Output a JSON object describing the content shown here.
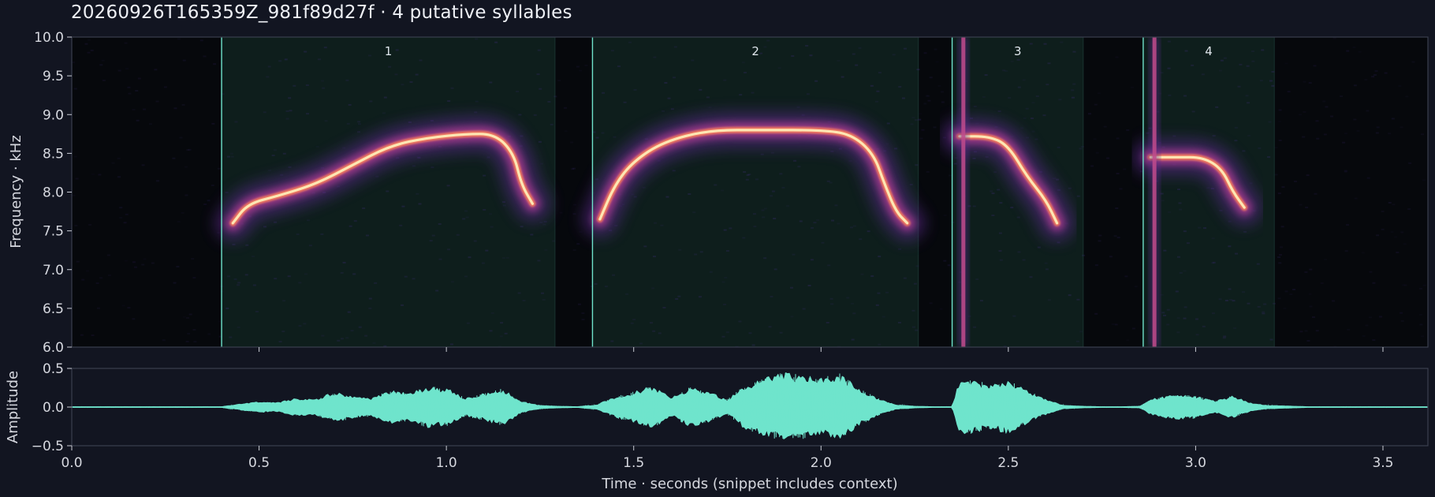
{
  "title": "20260926T165359Z_981f89d27f  ·  4 putative syllables",
  "chart_data": [
    {
      "type": "heatmap",
      "name": "spectrogram",
      "ylabel": "Frequency · kHz",
      "xlim": [
        0.0,
        3.62
      ],
      "ylim": [
        6.0,
        10.0
      ],
      "yticks": [
        6.0,
        6.5,
        7.0,
        7.5,
        8.0,
        8.5,
        9.0,
        9.5,
        10.0
      ],
      "xticks": [
        0.5,
        1.0,
        1.5,
        2.0,
        2.5,
        3.0,
        3.5
      ],
      "syllables": [
        {
          "label": "1",
          "start": 0.4,
          "end": 1.29
        },
        {
          "label": "2",
          "start": 1.39,
          "end": 2.26
        },
        {
          "label": "3",
          "start": 2.35,
          "end": 2.7
        },
        {
          "label": "4",
          "start": 2.86,
          "end": 3.21
        }
      ],
      "ridges": [
        {
          "points": [
            [
              0.43,
              7.6
            ],
            [
              0.47,
              7.85
            ],
            [
              0.55,
              7.95
            ],
            [
              0.65,
              8.1
            ],
            [
              0.75,
              8.35
            ],
            [
              0.85,
              8.6
            ],
            [
              0.95,
              8.7
            ],
            [
              1.05,
              8.75
            ],
            [
              1.13,
              8.75
            ],
            [
              1.18,
              8.5
            ],
            [
              1.2,
              8.1
            ],
            [
              1.23,
              7.85
            ]
          ]
        },
        {
          "points": [
            [
              1.41,
              7.65
            ],
            [
              1.45,
              8.1
            ],
            [
              1.5,
              8.4
            ],
            [
              1.58,
              8.65
            ],
            [
              1.7,
              8.8
            ],
            [
              1.85,
              8.8
            ],
            [
              2.0,
              8.8
            ],
            [
              2.08,
              8.75
            ],
            [
              2.14,
              8.5
            ],
            [
              2.17,
              8.1
            ],
            [
              2.2,
              7.75
            ],
            [
              2.23,
              7.6
            ]
          ]
        },
        {
          "points": [
            [
              2.37,
              8.72
            ],
            [
              2.45,
              8.72
            ],
            [
              2.5,
              8.6
            ],
            [
              2.55,
              8.2
            ],
            [
              2.6,
              7.9
            ],
            [
              2.63,
              7.6
            ]
          ]
        },
        {
          "points": [
            [
              2.88,
              8.45
            ],
            [
              2.95,
              8.45
            ],
            [
              3.02,
              8.45
            ],
            [
              3.07,
              8.3
            ],
            [
              3.1,
              8.0
            ],
            [
              3.13,
              7.8
            ]
          ]
        }
      ],
      "broadband_clicks": [
        2.38,
        2.89
      ]
    },
    {
      "type": "area",
      "name": "waveform",
      "xlabel": "Time · seconds (snippet includes context)",
      "ylabel": "Amplitude",
      "xlim": [
        0.0,
        3.62
      ],
      "ylim": [
        -0.5,
        0.5
      ],
      "yticks": [
        -0.5,
        0.0,
        0.5
      ],
      "xticks": [
        0.0,
        0.5,
        1.0,
        1.5,
        2.0,
        2.5,
        3.0,
        3.5
      ],
      "x": [
        0.0,
        0.4,
        0.45,
        0.5,
        0.55,
        0.6,
        0.65,
        0.7,
        0.75,
        0.8,
        0.85,
        0.9,
        0.95,
        1.0,
        1.05,
        1.1,
        1.15,
        1.2,
        1.25,
        1.3,
        1.35,
        1.4,
        1.45,
        1.5,
        1.55,
        1.6,
        1.65,
        1.7,
        1.75,
        1.8,
        1.85,
        1.9,
        1.95,
        2.0,
        2.05,
        2.1,
        2.15,
        2.2,
        2.25,
        2.3,
        2.35,
        2.37,
        2.4,
        2.45,
        2.5,
        2.55,
        2.6,
        2.65,
        2.7,
        2.75,
        2.8,
        2.85,
        2.88,
        2.9,
        2.95,
        3.0,
        3.05,
        3.1,
        3.15,
        3.2,
        3.3,
        3.62
      ],
      "envelope": [
        0.005,
        0.005,
        0.04,
        0.07,
        0.06,
        0.12,
        0.1,
        0.2,
        0.15,
        0.12,
        0.22,
        0.18,
        0.27,
        0.25,
        0.12,
        0.18,
        0.24,
        0.08,
        0.02,
        0.01,
        0.005,
        0.03,
        0.14,
        0.2,
        0.28,
        0.12,
        0.26,
        0.2,
        0.1,
        0.3,
        0.38,
        0.45,
        0.42,
        0.38,
        0.44,
        0.25,
        0.12,
        0.03,
        0.01,
        0.005,
        0.005,
        0.36,
        0.36,
        0.3,
        0.35,
        0.22,
        0.1,
        0.02,
        0.01,
        0.005,
        0.005,
        0.01,
        0.1,
        0.13,
        0.16,
        0.15,
        0.08,
        0.15,
        0.05,
        0.02,
        0.005,
        0.005
      ]
    }
  ],
  "colors": {
    "background": "#121521",
    "plot_bg": "#06080c",
    "accent": "#6fe4cc",
    "syllable_fill": "#0e1e1c",
    "tick_text": "#d6d8df"
  }
}
